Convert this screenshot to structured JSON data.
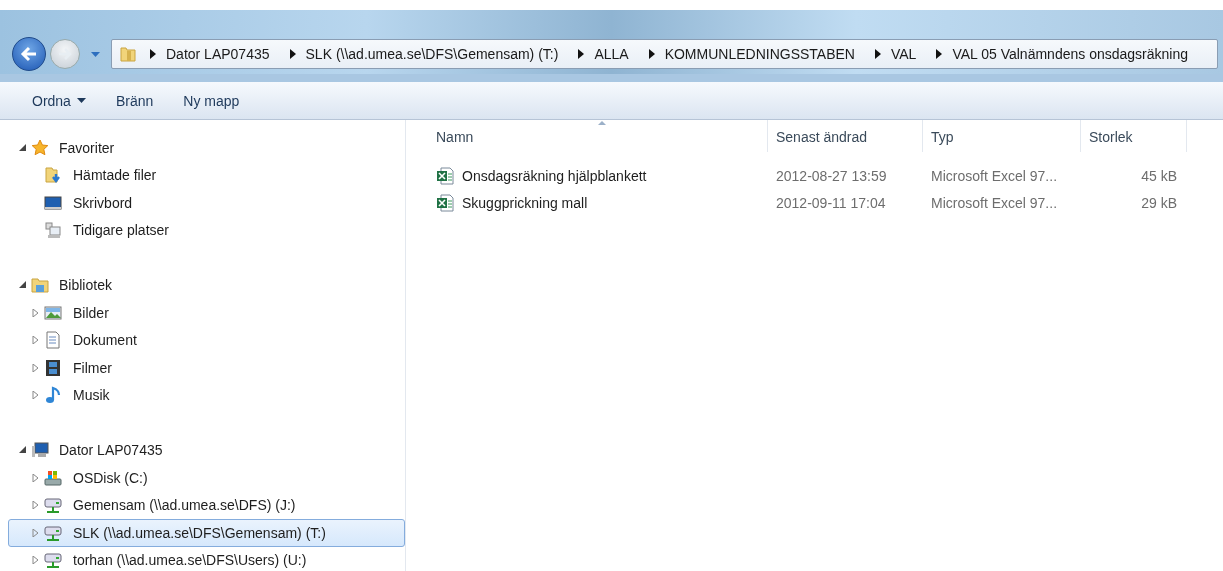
{
  "address_bar": {
    "crumbs": [
      "Dator LAP07435",
      "SLK (\\\\ad.umea.se\\DFS\\Gemensam) (T:)",
      "ALLA",
      "KOMMUNLEDNINGSSTABEN",
      "VAL",
      "VAL 05 Valnämndens onsdagsräkning"
    ]
  },
  "toolbar": {
    "buttons": [
      {
        "label": "Ordna",
        "has_menu": true
      },
      {
        "label": "Bränn",
        "has_menu": false
      },
      {
        "label": "Ny mapp",
        "has_menu": false
      }
    ]
  },
  "sidebar": {
    "sections": [
      {
        "label": "Favoriter",
        "kind": "favorites",
        "expanded": true,
        "children": [
          {
            "label": "Hämtade filer",
            "kind": "downloads",
            "expandable": false,
            "selected": false
          },
          {
            "label": "Skrivbord",
            "kind": "desktop",
            "expandable": false,
            "selected": false
          },
          {
            "label": "Tidigare platser",
            "kind": "recent",
            "expandable": false,
            "selected": false
          }
        ]
      },
      {
        "label": "Bibliotek",
        "kind": "library",
        "expanded": true,
        "children": [
          {
            "label": "Bilder",
            "kind": "pictures",
            "expandable": true,
            "selected": false
          },
          {
            "label": "Dokument",
            "kind": "documents",
            "expandable": true,
            "selected": false
          },
          {
            "label": "Filmer",
            "kind": "videos",
            "expandable": true,
            "selected": false
          },
          {
            "label": "Musik",
            "kind": "music",
            "expandable": true,
            "selected": false
          }
        ]
      },
      {
        "label": "Dator LAP07435",
        "kind": "computer",
        "expanded": true,
        "children": [
          {
            "label": "OSDisk (C:)",
            "kind": "disk",
            "expandable": true,
            "selected": false
          },
          {
            "label": "Gemensam (\\\\ad.umea.se\\DFS) (J:)",
            "kind": "network-drive",
            "expandable": true,
            "selected": false
          },
          {
            "label": "SLK (\\\\ad.umea.se\\DFS\\Gemensam) (T:)",
            "kind": "network-drive",
            "expandable": true,
            "selected": true
          },
          {
            "label": "torhan (\\\\ad.umea.se\\DFS\\Users) (U:)",
            "kind": "network-drive",
            "expandable": true,
            "selected": false
          }
        ]
      }
    ]
  },
  "file_list": {
    "columns": [
      {
        "label": "Namn",
        "sorted": true
      },
      {
        "label": "Senast ändrad",
        "sorted": false
      },
      {
        "label": "Typ",
        "sorted": false
      },
      {
        "label": "Storlek",
        "sorted": false
      }
    ],
    "rows": [
      {
        "name": "Onsdagsräkning hjälpblankett",
        "modified": "2012-08-27 13:59",
        "type": "Microsoft Excel 97...",
        "size": "45 kB"
      },
      {
        "name": "Skuggprickning mall",
        "modified": "2012-09-11 17:04",
        "type": "Microsoft Excel 97...",
        "size": "29 kB"
      }
    ]
  }
}
